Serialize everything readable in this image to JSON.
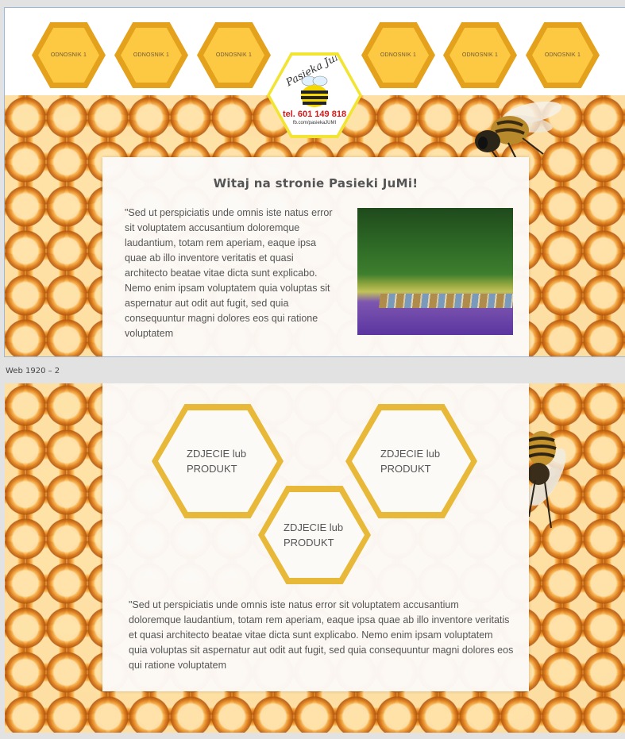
{
  "artboard1": {
    "nav": {
      "left_links": [
        "ODNOSNIK 1",
        "ODNOSNIK 1",
        "ODNOSNIK 1"
      ],
      "right_links": [
        "ODNOSNIK 1",
        "ODNOSNIK 1",
        "ODNOSNIK 1"
      ]
    },
    "logo": {
      "script": "Pasieka JuMi",
      "phone": "tel. 601 149 818",
      "fb": "fb.com/pasiekaJUMI"
    },
    "welcome_title": "Witaj na stronie Pasieki JuMi!",
    "intro_text": "\"Sed ut perspiciatis unde omnis iste natus error sit voluptatem accusantium doloremque laudantium, totam rem aperiam, eaque ipsa quae ab illo inventore veritatis et quasi architecto beatae vitae dicta sunt explicabo. Nemo enim ipsam voluptatem quia voluptas sit aspernatur aut odit aut fugit, sed quia consequuntur magni dolores eos qui ratione voluptatem"
  },
  "artboard2_label": "Web 1920 – 2",
  "artboard2": {
    "products": [
      "ZDJECIE lub PRODUKT",
      "ZDJECIE lub PRODUKT",
      "ZDJECIE lub PRODUKT"
    ],
    "bottom_text": "\"Sed ut perspiciatis unde omnis iste natus error sit voluptatem accusantium doloremque laudantium, totam rem aperiam, eaque ipsa quae ab illo inventore veritatis et quasi architecto beatae vitae dicta sunt explicabo. Nemo enim ipsam voluptatem quia voluptas sit aspernatur aut odit aut fugit, sed quia consequuntur magni dolores eos qui ratione voluptatem"
  },
  "colors": {
    "hex_outer": "#e4a11b",
    "hex_inner": "#fdc842",
    "product_border": "#e8b838",
    "logo_border": "#f2e433",
    "phone_red": "#d41a1a",
    "honey": "#f3a33c"
  },
  "icons": {
    "bee": "bee-icon",
    "logo_bee": "bee-logo-icon"
  }
}
